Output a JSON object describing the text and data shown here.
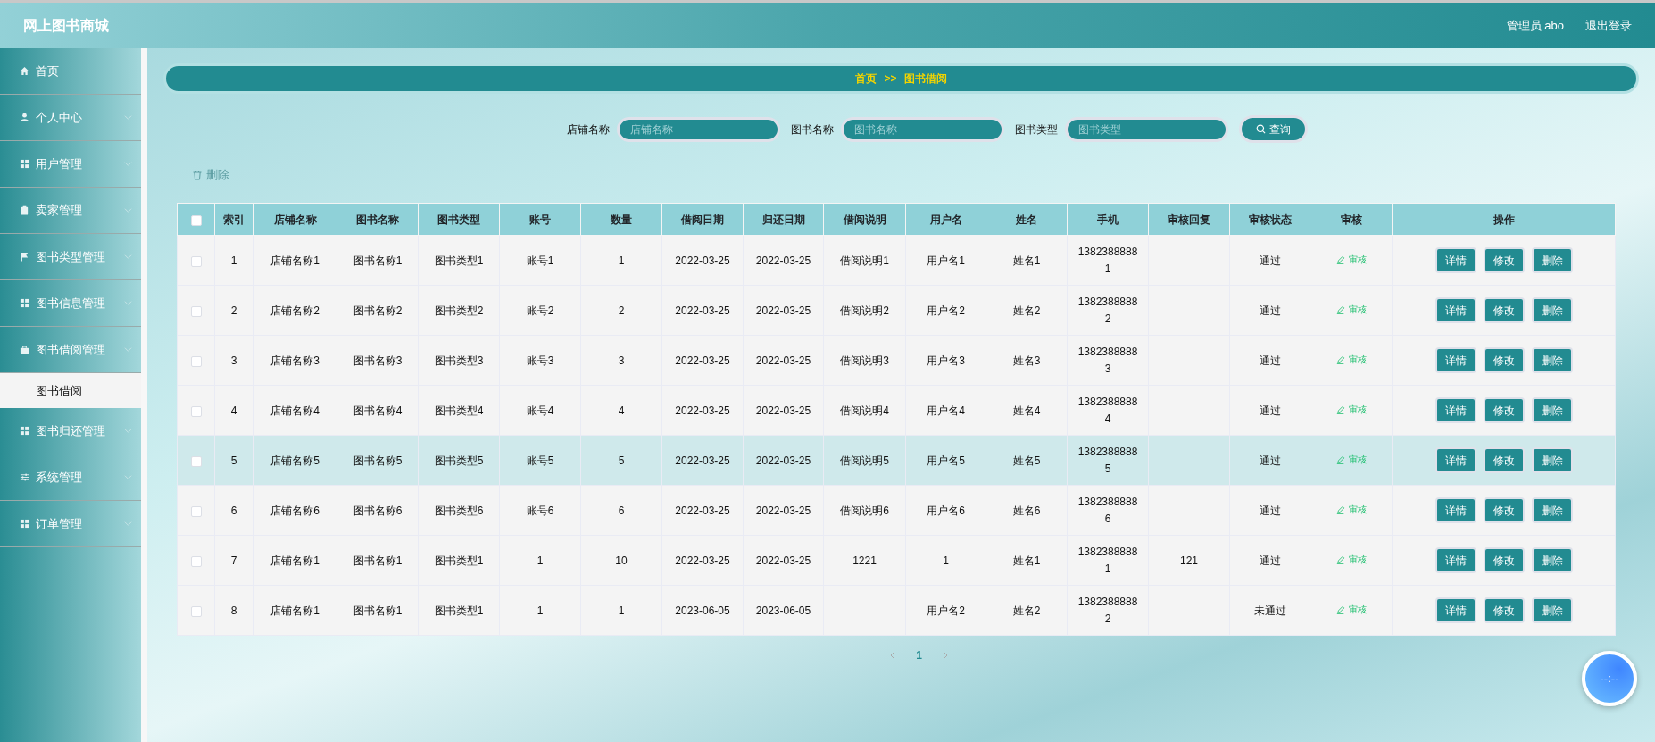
{
  "header": {
    "title": "网上图书商城",
    "user": "管理员 abo",
    "logout": "退出登录"
  },
  "sidebar": {
    "items": [
      {
        "kind": "home",
        "label": "首页",
        "expandable": false
      },
      {
        "kind": "person",
        "label": "个人中心",
        "expandable": true
      },
      {
        "kind": "grid",
        "label": "用户管理",
        "expandable": true
      },
      {
        "kind": "clipboard",
        "label": "卖家管理",
        "expandable": true
      },
      {
        "kind": "flag",
        "label": "图书类型管理",
        "expandable": true
      },
      {
        "kind": "grid",
        "label": "图书信息管理",
        "expandable": true
      },
      {
        "kind": "briefcase",
        "label": "图书借阅管理",
        "expandable": true,
        "children": [
          {
            "label": "图书借阅",
            "selected": true
          }
        ]
      },
      {
        "kind": "grid",
        "label": "图书归还管理",
        "expandable": true
      },
      {
        "kind": "sliders",
        "label": "系统管理",
        "expandable": true
      },
      {
        "kind": "grid",
        "label": "订单管理",
        "expandable": true
      }
    ]
  },
  "breadcrumb": [
    "首页",
    ">>",
    "图书借阅"
  ],
  "search": {
    "fields": [
      {
        "label": "店铺名称",
        "placeholder": "店铺名称"
      },
      {
        "label": "图书名称",
        "placeholder": "图书名称"
      },
      {
        "label": "图书类型",
        "placeholder": "图书类型"
      }
    ],
    "button": "查询"
  },
  "delete_button": "删除",
  "table": {
    "header_checked": false,
    "columns": [
      "索引",
      "店铺名称",
      "图书名称",
      "图书类型",
      "账号",
      "数量",
      "借阅日期",
      "归还日期",
      "借阅说明",
      "用户名",
      "姓名",
      "手机",
      "审核回复",
      "审核状态",
      "审核",
      "操作"
    ],
    "rows": [
      {
        "checked": false,
        "highlighted": false,
        "cells": [
          "1",
          "店铺名称1",
          "图书名称1",
          "图书类型1",
          "账号1",
          "1",
          "2022-03-25",
          "2022-03-25",
          "借阅说明1",
          "用户名1",
          "姓名1",
          "13823888881",
          "",
          "通过"
        ],
        "review": "审核",
        "actions": [
          "详情",
          "修改",
          "删除"
        ]
      },
      {
        "checked": false,
        "highlighted": false,
        "cells": [
          "2",
          "店铺名称2",
          "图书名称2",
          "图书类型2",
          "账号2",
          "2",
          "2022-03-25",
          "2022-03-25",
          "借阅说明2",
          "用户名2",
          "姓名2",
          "13823888882",
          "",
          "通过"
        ],
        "review": "审核",
        "actions": [
          "详情",
          "修改",
          "删除"
        ]
      },
      {
        "checked": false,
        "highlighted": false,
        "cells": [
          "3",
          "店铺名称3",
          "图书名称3",
          "图书类型3",
          "账号3",
          "3",
          "2022-03-25",
          "2022-03-25",
          "借阅说明3",
          "用户名3",
          "姓名3",
          "13823888883",
          "",
          "通过"
        ],
        "review": "审核",
        "actions": [
          "详情",
          "修改",
          "删除"
        ]
      },
      {
        "checked": false,
        "highlighted": false,
        "cells": [
          "4",
          "店铺名称4",
          "图书名称4",
          "图书类型4",
          "账号4",
          "4",
          "2022-03-25",
          "2022-03-25",
          "借阅说明4",
          "用户名4",
          "姓名4",
          "13823888884",
          "",
          "通过"
        ],
        "review": "审核",
        "actions": [
          "详情",
          "修改",
          "删除"
        ]
      },
      {
        "checked": false,
        "highlighted": true,
        "cells": [
          "5",
          "店铺名称5",
          "图书名称5",
          "图书类型5",
          "账号5",
          "5",
          "2022-03-25",
          "2022-03-25",
          "借阅说明5",
          "用户名5",
          "姓名5",
          "13823888885",
          "",
          "通过"
        ],
        "review": "审核",
        "actions": [
          "详情",
          "修改",
          "删除"
        ]
      },
      {
        "checked": false,
        "highlighted": false,
        "cells": [
          "6",
          "店铺名称6",
          "图书名称6",
          "图书类型6",
          "账号6",
          "6",
          "2022-03-25",
          "2022-03-25",
          "借阅说明6",
          "用户名6",
          "姓名6",
          "13823888886",
          "",
          "通过"
        ],
        "review": "审核",
        "actions": [
          "详情",
          "修改",
          "删除"
        ]
      },
      {
        "checked": false,
        "highlighted": false,
        "cells": [
          "7",
          "店铺名称1",
          "图书名称1",
          "图书类型1",
          "1",
          "10",
          "2022-03-25",
          "2022-03-25",
          "1221",
          "1",
          "姓名1",
          "13823888881",
          "121",
          "通过"
        ],
        "review": "审核",
        "actions": [
          "详情",
          "修改",
          "删除"
        ]
      },
      {
        "checked": false,
        "highlighted": false,
        "cells": [
          "8",
          "店铺名称1",
          "图书名称1",
          "图书类型1",
          "1",
          "1",
          "2023-06-05",
          "2023-06-05",
          "",
          "用户名2",
          "姓名2",
          "13823888882",
          "",
          "未通过"
        ],
        "review": "审核",
        "actions": [
          "详情",
          "修改",
          "删除"
        ]
      }
    ]
  },
  "pagination": {
    "pages": [
      {
        "label": "1",
        "selected": true
      }
    ]
  },
  "float_clock": "--:--"
}
